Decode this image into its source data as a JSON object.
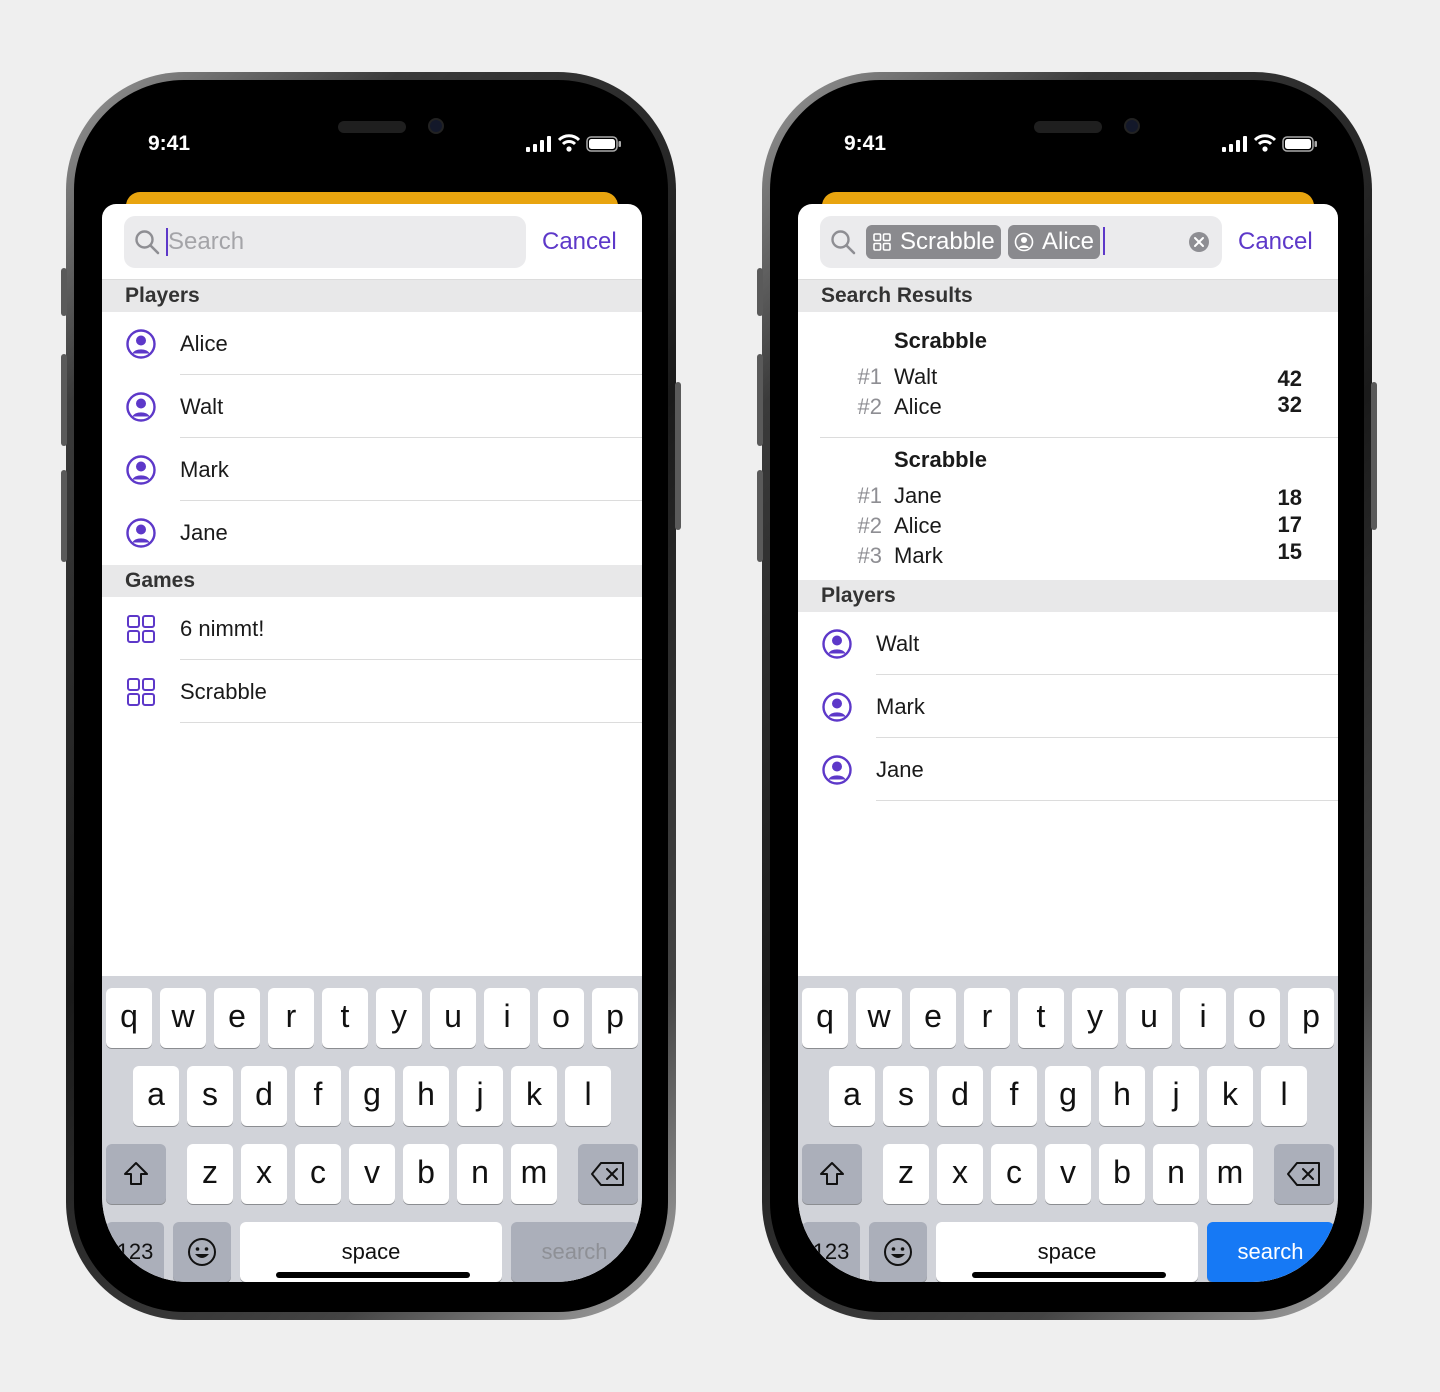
{
  "colors": {
    "accent": "#5d38c9",
    "sheet_tab": "#e8a40f",
    "search_key_active": "#1679f5"
  },
  "left_phone": {
    "status": {
      "time": "9:41"
    },
    "search": {
      "placeholder": "Search",
      "cancel_label": "Cancel"
    },
    "sections": [
      {
        "header": "Players",
        "icon": "person-circle-icon",
        "items": [
          "Alice",
          "Walt",
          "Mark",
          "Jane"
        ]
      },
      {
        "header": "Games",
        "icon": "grid-icon",
        "items": [
          "6 nimmt!",
          "Scrabble"
        ]
      }
    ],
    "keyboard": {
      "search_label": "search",
      "search_enabled": false
    }
  },
  "right_phone": {
    "status": {
      "time": "9:41"
    },
    "search": {
      "tokens": [
        {
          "label": "Scrabble",
          "icon": "grid-icon"
        },
        {
          "label": "Alice",
          "icon": "person-circle-icon"
        }
      ],
      "cancel_label": "Cancel"
    },
    "results_header": "Search Results",
    "results": [
      {
        "game": "Scrabble",
        "ranks": [
          {
            "rank": "#1",
            "name": "Walt",
            "score": "42"
          },
          {
            "rank": "#2",
            "name": "Alice",
            "score": "32"
          }
        ]
      },
      {
        "game": "Scrabble",
        "ranks": [
          {
            "rank": "#1",
            "name": "Jane",
            "score": "18"
          },
          {
            "rank": "#2",
            "name": "Alice",
            "score": "17"
          },
          {
            "rank": "#3",
            "name": "Mark",
            "score": "15"
          }
        ]
      }
    ],
    "players_header": "Players",
    "players": [
      "Walt",
      "Mark",
      "Jane"
    ],
    "keyboard": {
      "search_label": "search",
      "search_enabled": true
    }
  },
  "keyboard": {
    "row1": [
      "q",
      "w",
      "e",
      "r",
      "t",
      "y",
      "u",
      "i",
      "o",
      "p"
    ],
    "row2": [
      "a",
      "s",
      "d",
      "f",
      "g",
      "h",
      "j",
      "k",
      "l"
    ],
    "row3": [
      "z",
      "x",
      "c",
      "v",
      "b",
      "n",
      "m"
    ],
    "numbers_label": "123",
    "space_label": "space"
  }
}
